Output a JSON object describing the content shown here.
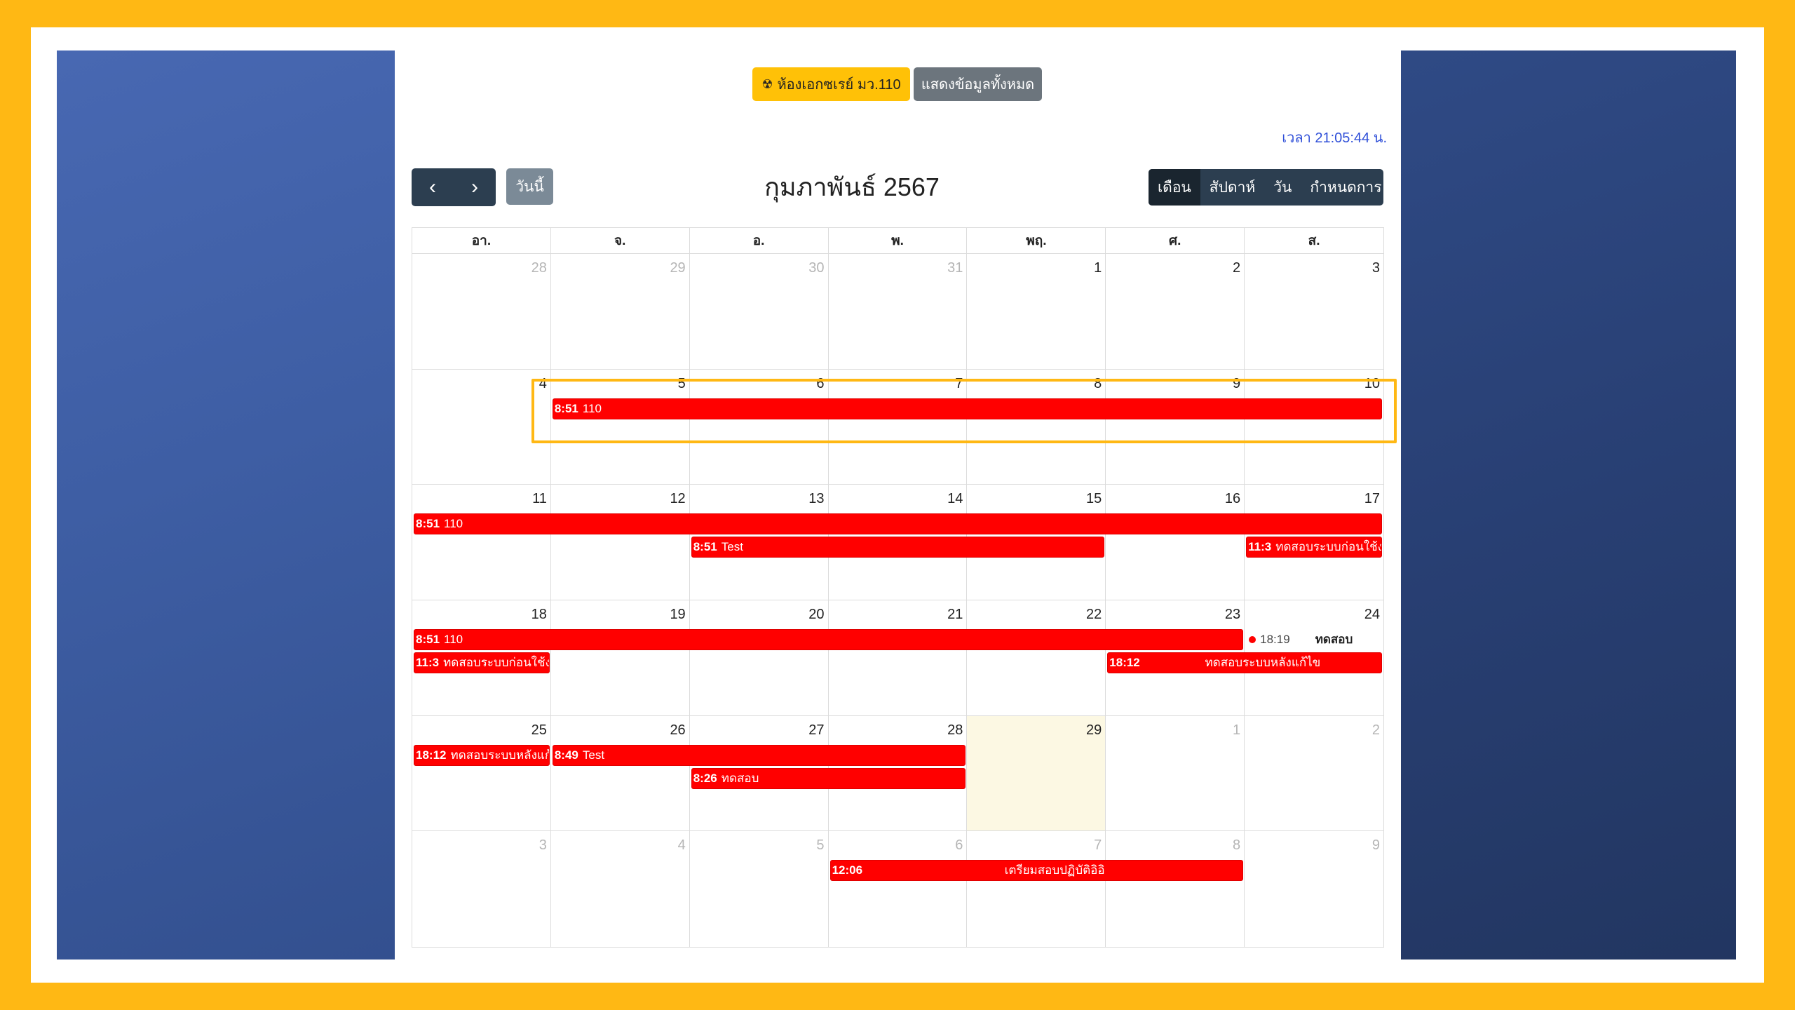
{
  "header": {
    "room_button": {
      "icon": "radiation-icon",
      "label": "ห้องเอกซเรย์ มว.110"
    },
    "show_all_label": "แสดงข้อมูลทั้งหมด",
    "clock": "เวลา 21:05:44 น."
  },
  "toolbar": {
    "prev_symbol": "‹",
    "next_symbol": "›",
    "today_label": "วันนี้",
    "title": "กุมภาพันธ์ 2567",
    "views": [
      "เดือน",
      "สัปดาห์",
      "วัน",
      "กำหนดการ"
    ],
    "active_view": "เดือน"
  },
  "calendar": {
    "weekdays": [
      "อา.",
      "จ.",
      "อ.",
      "พ.",
      "พฤ.",
      "ศ.",
      "ส."
    ],
    "weeks": [
      [
        {
          "n": "28",
          "other": true
        },
        {
          "n": "29",
          "other": true
        },
        {
          "n": "30",
          "other": true
        },
        {
          "n": "31",
          "other": true
        },
        {
          "n": "1"
        },
        {
          "n": "2"
        },
        {
          "n": "3"
        }
      ],
      [
        {
          "n": "4"
        },
        {
          "n": "5"
        },
        {
          "n": "6"
        },
        {
          "n": "7"
        },
        {
          "n": "8"
        },
        {
          "n": "9"
        },
        {
          "n": "10"
        }
      ],
      [
        {
          "n": "11"
        },
        {
          "n": "12"
        },
        {
          "n": "13"
        },
        {
          "n": "14"
        },
        {
          "n": "15"
        },
        {
          "n": "16"
        },
        {
          "n": "17"
        }
      ],
      [
        {
          "n": "18"
        },
        {
          "n": "19"
        },
        {
          "n": "20"
        },
        {
          "n": "21"
        },
        {
          "n": "22"
        },
        {
          "n": "23"
        },
        {
          "n": "24"
        }
      ],
      [
        {
          "n": "25"
        },
        {
          "n": "26"
        },
        {
          "n": "27"
        },
        {
          "n": "28"
        },
        {
          "n": "29",
          "today": true
        },
        {
          "n": "1",
          "other": true
        },
        {
          "n": "2",
          "other": true
        }
      ],
      [
        {
          "n": "3",
          "other": true
        },
        {
          "n": "4",
          "other": true
        },
        {
          "n": "5",
          "other": true
        },
        {
          "n": "6",
          "other": true
        },
        {
          "n": "7",
          "other": true
        },
        {
          "n": "8",
          "other": true
        },
        {
          "n": "9",
          "other": true
        }
      ]
    ],
    "events": [
      {
        "week": 1,
        "start": 1,
        "end": 6,
        "row": 0,
        "time": "8:51",
        "title": "110"
      },
      {
        "week": 2,
        "start": 0,
        "end": 6,
        "row": 0,
        "time": "8:51",
        "title": "110"
      },
      {
        "week": 2,
        "start": 2,
        "end": 4,
        "row": 1,
        "time": "8:51",
        "title": "Test"
      },
      {
        "week": 2,
        "start": 6,
        "end": 6,
        "row": 1,
        "time": "11:3",
        "title": "ทดสอบระบบก่อนใช้ง"
      },
      {
        "week": 3,
        "start": 0,
        "end": 5,
        "row": 0,
        "time": "8:51",
        "title": "110"
      },
      {
        "week": 3,
        "start": 6,
        "end": 6,
        "row": 0,
        "time": "18:19",
        "title": "ทดสอบ",
        "dot": true
      },
      {
        "week": 3,
        "start": 0,
        "end": 0,
        "row": 1,
        "time": "11:3",
        "title": "ทดสอบระบบก่อนใช้ง"
      },
      {
        "week": 3,
        "start": 5,
        "end": 6,
        "row": 1,
        "time": "18:12",
        "title": "ทดสอบระบบหลังแก้ไข",
        "centered": true
      },
      {
        "week": 4,
        "start": 0,
        "end": 0,
        "row": 0,
        "time": "18:12",
        "title": "ทดสอบระบบหลังแก้ไ"
      },
      {
        "week": 4,
        "start": 1,
        "end": 3,
        "row": 0,
        "time": "8:49",
        "title": "Test"
      },
      {
        "week": 4,
        "start": 2,
        "end": 3,
        "row": 1,
        "time": "8:26",
        "title": "ทดสอบ"
      },
      {
        "week": 5,
        "start": 3,
        "end": 5,
        "row": 0,
        "time": "12:06",
        "title": "เตรียมสอบปฏิบัติอิอิ",
        "centered": true
      }
    ]
  },
  "colors": {
    "frame": "#FFB814",
    "event": "#ff0000",
    "today_cell": "#FCF8E3",
    "toolbar_dark": "#2c3e50",
    "room_button": "#FFC107",
    "clock_text": "#2f4fd8"
  }
}
